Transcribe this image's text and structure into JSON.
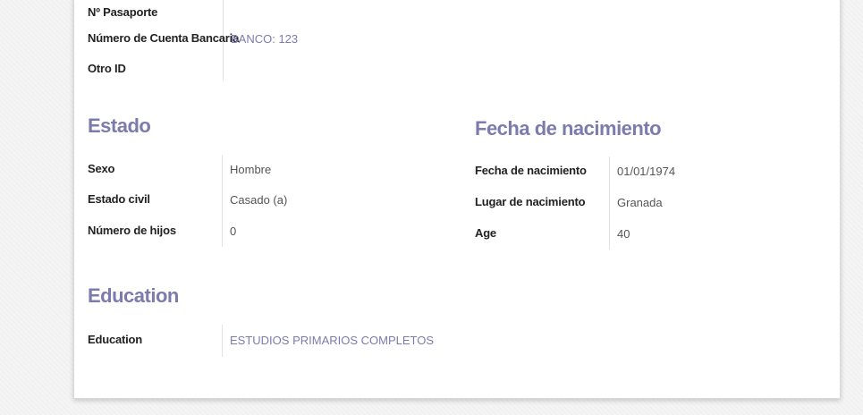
{
  "identification": {
    "passport_label": "Nº Pasaporte",
    "passport_value": "",
    "bank_account_label": "Número de Cuenta Bancaria",
    "bank_account_value": "BANCO: 123",
    "other_id_label": "Otro ID",
    "other_id_value": ""
  },
  "status": {
    "title": "Estado",
    "gender_label": "Sexo",
    "gender_value": "Hombre",
    "marital_label": "Estado civil",
    "marital_value": "Casado (a)",
    "children_label": "Número de hijos",
    "children_value": "0"
  },
  "birth": {
    "title": "Fecha de nacimiento",
    "date_label": "Fecha de nacimiento",
    "date_value": "01/01/1974",
    "place_label": "Lugar de nacimiento",
    "place_value": "Granada",
    "age_label": "Age",
    "age_value": "40"
  },
  "education": {
    "title": "Education",
    "education_label": "Education",
    "education_value": "ESTUDIOS PRIMARIOS COMPLETOS"
  },
  "colors": {
    "accent": "#7c7bad",
    "label_text": "#222222",
    "value_text": "#555555",
    "background": "#f4f4f4"
  }
}
